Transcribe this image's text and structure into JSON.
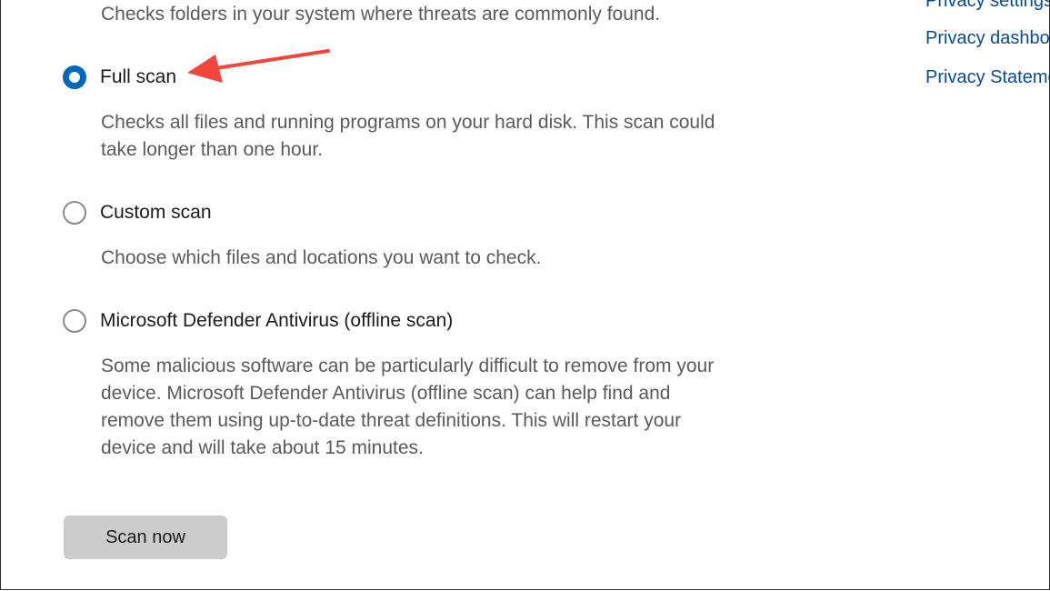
{
  "scan_options": {
    "quick_desc": "Checks folders in your system where threats are commonly found.",
    "options": [
      {
        "label": "Full scan",
        "checked": true,
        "description": "Checks all files and running programs on your hard disk. This scan could take longer than one hour."
      },
      {
        "label": "Custom scan",
        "checked": false,
        "description": "Choose which files and locations you want to check."
      },
      {
        "label": "Microsoft Defender Antivirus (offline scan)",
        "checked": false,
        "description": "Some malicious software can be particularly difficult to remove from your device. Microsoft Defender Antivirus (offline scan) can help find and remove them using up-to-date threat definitions. This will restart your device and will take about 15 minutes."
      }
    ]
  },
  "sidebar_links": [
    "Privacy settings",
    "Privacy dashboard",
    "Privacy Statement"
  ],
  "actions": {
    "scan_now_label": "Scan now"
  },
  "colors": {
    "accent": "#0067c0",
    "link": "#0a4a91",
    "annotation_arrow": "#f0463c",
    "button_bg": "#cccccc"
  },
  "icons": {
    "annotation": "red-arrow-icon"
  }
}
